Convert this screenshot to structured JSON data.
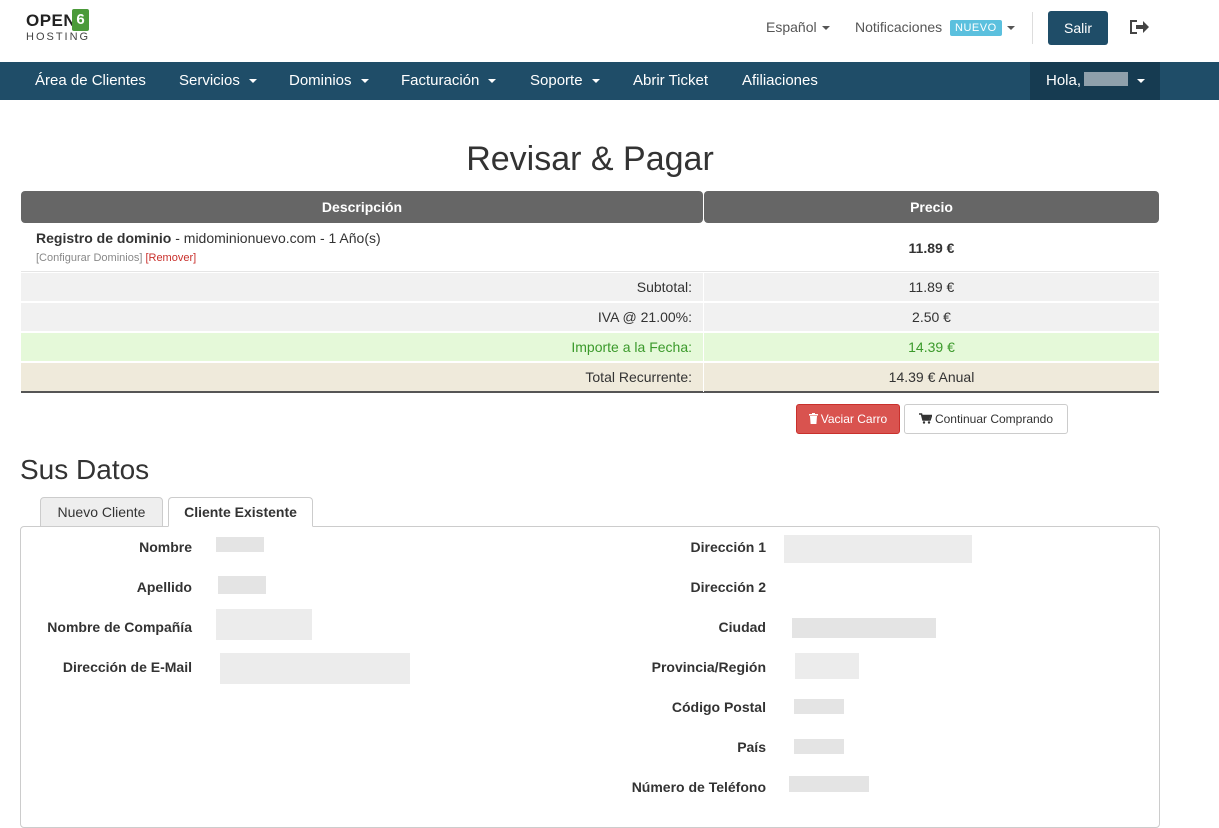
{
  "header": {
    "logo_text": "OPEN",
    "logo_number": "6",
    "logo_subtext": "HOSTING",
    "language": "Español",
    "notifications_label": "Notificaciones",
    "notifications_badge": "NUEVO",
    "logout_button": "Salir"
  },
  "nav": {
    "items": [
      "Área de Clientes",
      "Servicios",
      "Dominios",
      "Facturación",
      "Soporte",
      "Abrir Ticket",
      "Afiliaciones"
    ],
    "greeting": "Hola,"
  },
  "page": {
    "title": "Revisar & Pagar"
  },
  "cart": {
    "columns": [
      "Descripción",
      "Precio"
    ],
    "item": {
      "type": "Registro de dominio",
      "detail": " - midominionuevo.com - 1 Año(s)",
      "configure_link": "[Configurar Dominios]",
      "remove_link": "[Remover]",
      "price": "11.89 €"
    },
    "summary": [
      {
        "label": "Subtotal:",
        "value": "11.89 €"
      },
      {
        "label": "IVA @ 21.00%:",
        "value": "2.50 €"
      },
      {
        "label": "Importe a la Fecha:",
        "value": "14.39 €"
      },
      {
        "label": "Total Recurrente:",
        "value": "14.39 € Anual"
      }
    ],
    "empty_button": "Vaciar Carro",
    "continue_button": "Continuar Comprando"
  },
  "details": {
    "title": "Sus Datos",
    "tabs": [
      "Nuevo Cliente",
      "Cliente Existente"
    ],
    "active_tab": "Cliente Existente",
    "left_fields": [
      "Nombre",
      "Apellido",
      "Nombre de Compañía",
      "Dirección de E-Mail"
    ],
    "right_fields": [
      "Dirección 1",
      "Dirección 2",
      "Ciudad",
      "Provincia/Región",
      "Código Postal",
      "País",
      "Número de Teléfono"
    ]
  },
  "colors": {
    "primary": "#1f4d68",
    "danger": "#d9534f",
    "badge": "#5bc0de",
    "success_text": "#3b9a2b",
    "success_bg": "#e5f9d9"
  }
}
